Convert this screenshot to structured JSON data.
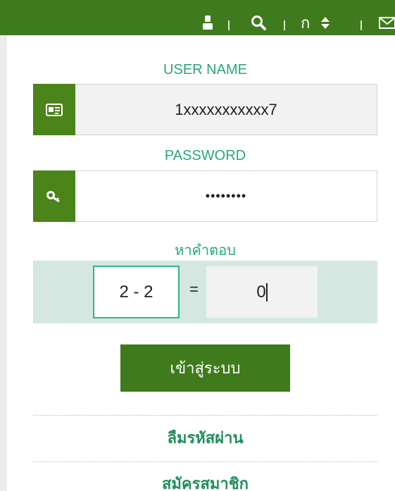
{
  "topbar": {
    "icons": [
      "user-icon",
      "search-icon",
      "font-size-icon",
      "mail-icon"
    ],
    "font_size_label": "ก"
  },
  "login": {
    "username_label": "USER NAME",
    "username_value": "1xxxxxxxxxxx7",
    "password_label": "PASSWORD",
    "password_value": "••••••••",
    "captcha_label": "หาคำตอบ",
    "captcha_question": "2 - 2",
    "captcha_equals": "=",
    "captcha_answer": "0",
    "submit_label": "เข้าสู่ระบบ"
  },
  "links": {
    "forgot_password": "ลืมรหัสผ่าน",
    "register": "สมัครสมาชิก"
  }
}
